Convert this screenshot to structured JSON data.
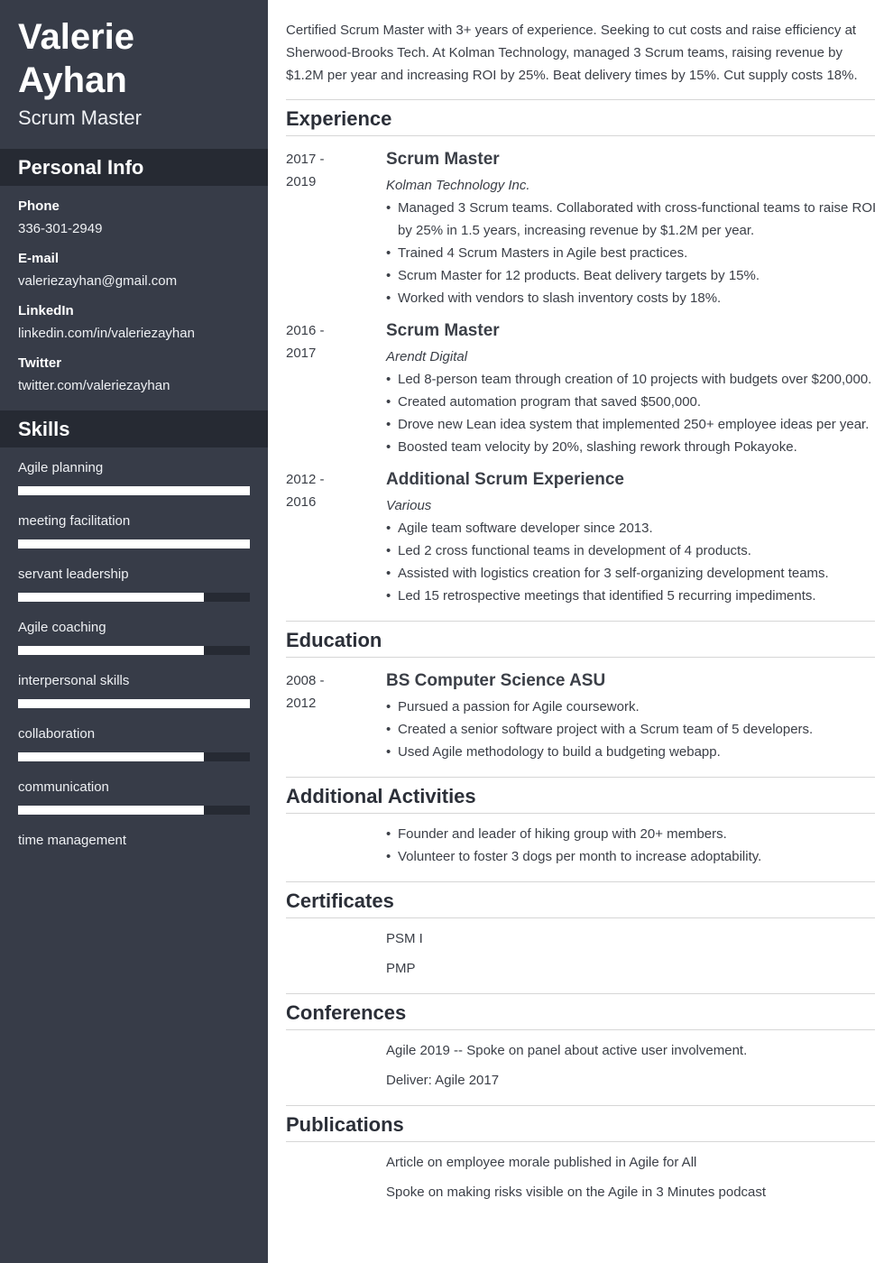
{
  "header": {
    "first_name": "Valerie",
    "last_name": "Ayhan",
    "job_title": "Scrum Master"
  },
  "sidebar": {
    "personal_info_title": "Personal Info",
    "contacts": [
      {
        "label": "Phone",
        "value": "336-301-2949"
      },
      {
        "label": "E-mail",
        "value": "valeriezayhan@gmail.com"
      },
      {
        "label": "LinkedIn",
        "value": "linkedin.com/in/valeriezayhan"
      },
      {
        "label": "Twitter",
        "value": "twitter.com/valeriezayhan"
      }
    ],
    "skills_title": "Skills",
    "skills": [
      {
        "name": "Agile planning",
        "level": 1.0
      },
      {
        "name": "meeting facilitation",
        "level": 1.0
      },
      {
        "name": "servant leadership",
        "level": 0.8
      },
      {
        "name": "Agile coaching",
        "level": 0.8
      },
      {
        "name": "interpersonal skills",
        "level": 1.0
      },
      {
        "name": "collaboration",
        "level": 0.8
      },
      {
        "name": "communication",
        "level": 0.8
      },
      {
        "name": "time management",
        "level": null
      }
    ]
  },
  "main": {
    "summary": "Certified Scrum Master with 3+ years of experience. Seeking to cut costs and raise efficiency at Sherwood-Brooks Tech. At Kolman Technology, managed 3 Scrum teams, raising revenue by $1.2M per year and increasing ROI by 25%. Beat delivery times by 15%. Cut supply costs 18%.",
    "experience": {
      "title": "Experience",
      "jobs": [
        {
          "date_start": "2017 -",
          "date_end": "2019",
          "title": "Scrum Master",
          "company": "Kolman Technology Inc.",
          "bullets": [
            "Managed 3 Scrum teams. Collaborated with cross-functional teams to raise ROI by 25% in 1.5 years, increasing revenue by $1.2M per year.",
            "Trained 4 Scrum Masters in Agile best practices.",
            "Scrum Master for 12 products. Beat delivery targets by 15%.",
            "Worked with vendors to slash inventory costs by 18%."
          ]
        },
        {
          "date_start": "2016 -",
          "date_end": "2017",
          "title": "Scrum Master",
          "company": "Arendt Digital",
          "bullets": [
            "Led 8-person team through creation of 10 projects with budgets over $200,000.",
            "Created automation program that saved $500,000.",
            "Drove new Lean idea system that implemented 250+ employee ideas per year.",
            "Boosted team velocity by 20%, slashing rework through Pokayoke."
          ]
        },
        {
          "date_start": "2012 -",
          "date_end": "2016",
          "title": "Additional Scrum Experience",
          "company": "Various",
          "bullets": [
            "Agile team software developer since 2013.",
            "Led 2 cross functional teams in development of 4 products.",
            "Assisted with logistics creation for 3 self-organizing development teams.",
            "Led 15 retrospective meetings that identified 5 recurring impediments."
          ]
        }
      ]
    },
    "education": {
      "title": "Education",
      "date_start": "2008 -",
      "date_end": "2012",
      "degree": "BS Computer Science ASU",
      "bullets": [
        "Pursued a passion for Agile coursework.",
        "Created a senior software project with a Scrum team of 5 developers.",
        "Used Agile methodology to build a budgeting webapp."
      ]
    },
    "activities": {
      "title": "Additional Activities",
      "bullets": [
        "Founder and leader of hiking group with 20+ members.",
        "Volunteer to foster 3 dogs per month to increase adoptability."
      ]
    },
    "certificates": {
      "title": "Certificates",
      "items": [
        "PSM I",
        "PMP"
      ]
    },
    "conferences": {
      "title": "Conferences",
      "items": [
        "Agile 2019 -- Spoke on panel about active user involvement.",
        "Deliver: Agile 2017"
      ]
    },
    "publications": {
      "title": "Publications",
      "items": [
        "Article on employee morale published in Agile for All",
        "Spoke on making risks visible on the Agile in 3 Minutes podcast"
      ]
    }
  }
}
